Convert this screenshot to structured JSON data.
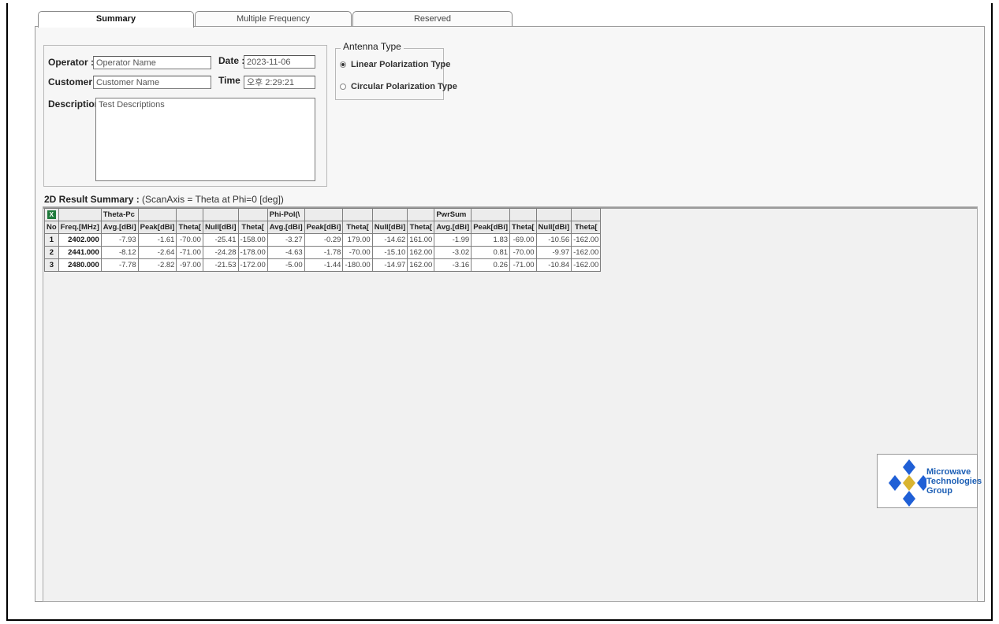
{
  "tabs": [
    {
      "label": "Summary",
      "active": true
    },
    {
      "label": "Multiple Frequency",
      "active": false
    },
    {
      "label": "Reserved",
      "active": false
    }
  ],
  "info": {
    "operator_label": "Operator :",
    "operator_value": "Operator Name",
    "customer_label": "Customer :",
    "customer_value": "Customer Name",
    "description_label": "Description :",
    "description_value": "Test Descriptions",
    "date_label": "Date :",
    "date_value": "2023-11-06",
    "time_label": "Time :",
    "time_value": "오후 2:29:21"
  },
  "antenna": {
    "title": "Antenna Type",
    "options": [
      {
        "label": "Linear Polarization Type",
        "selected": true
      },
      {
        "label": "Circular Polarization Type",
        "selected": false
      }
    ]
  },
  "summary": {
    "title": "2D Result Summary :",
    "subtitle": "(ScanAxis = Theta at Phi=0 [deg])"
  },
  "table": {
    "groups": [
      "Theta-Pc",
      "Phi-Pol(\\",
      "PwrSum"
    ],
    "headers": [
      "No",
      "Freq.[MHz]",
      "Avg.[dBi]",
      "Peak[dBi]",
      "Theta[",
      "Null[dBi]",
      "Theta[",
      "Avg.[dBi]",
      "Peak[dBi]",
      "Theta[",
      "Null[dBi]",
      "Theta[",
      "Avg.[dBi]",
      "Peak[dBi]",
      "Theta[",
      "Null[dBi]",
      "Theta["
    ],
    "rows": [
      [
        "1",
        "2402.000",
        "-7.93",
        "-1.61",
        "-70.00",
        "-25.41",
        "-158.00",
        "-3.27",
        "-0.29",
        "179.00",
        "-14.62",
        "161.00",
        "-1.99",
        "1.83",
        "-69.00",
        "-10.56",
        "-162.00"
      ],
      [
        "2",
        "2441.000",
        "-8.12",
        "-2.64",
        "-71.00",
        "-24.28",
        "-178.00",
        "-4.63",
        "-1.78",
        "-70.00",
        "-15.10",
        "162.00",
        "-3.02",
        "0.81",
        "-70.00",
        "-9.97",
        "-162.00"
      ],
      [
        "3",
        "2480.000",
        "-7.78",
        "-2.82",
        "-97.00",
        "-21.53",
        "-172.00",
        "-5.00",
        "-1.44",
        "-180.00",
        "-14.97",
        "162.00",
        "-3.16",
        "0.26",
        "-71.00",
        "-10.84",
        "-162.00"
      ]
    ]
  },
  "logo": {
    "line1": "Microwave",
    "line2": "Technologies",
    "line3": "Group",
    "blue": "#1f5fd6",
    "gold": "#d9b430"
  },
  "icons": {
    "export": "excel-export-icon"
  }
}
